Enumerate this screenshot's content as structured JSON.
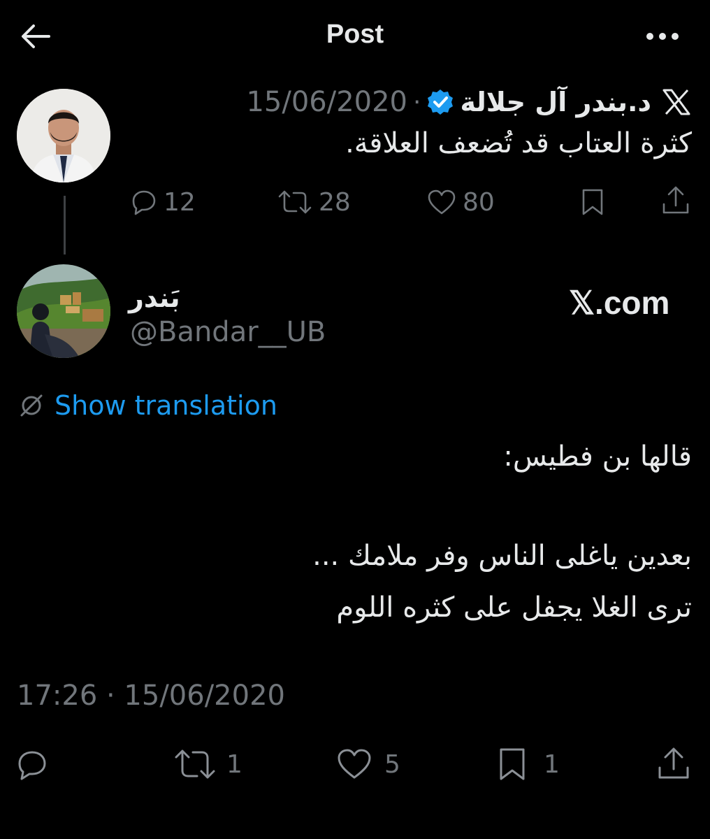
{
  "header": {
    "title": "Post"
  },
  "quoted_post": {
    "display_name": "د.بندر آل جلالة",
    "separator": "·",
    "date": "15/06/2020",
    "text": "كثرة العتاب قد تُضعف العلاقة.",
    "replies": "12",
    "reposts": "28",
    "likes": "80",
    "verified": true
  },
  "author": {
    "name": "بَندر",
    "handle": "@Bandar__UB"
  },
  "watermark": "𝕏.com",
  "translation": {
    "label": "Show translation"
  },
  "post": {
    "line1": "قالها بن فطيس:",
    "line2": "بعدين ياغلى الناس وفر ملامك ...",
    "line3": "ترى الغلا يجفل على كثره اللوم",
    "timestamp": "17:26 · 15/06/2020",
    "reposts": "1",
    "likes": "5",
    "bookmarks": "1"
  },
  "colors": {
    "background": "#000000",
    "text": "#e7e9ea",
    "muted": "#71767b",
    "link": "#1d9bf0",
    "verified": "#1d9bf0"
  }
}
